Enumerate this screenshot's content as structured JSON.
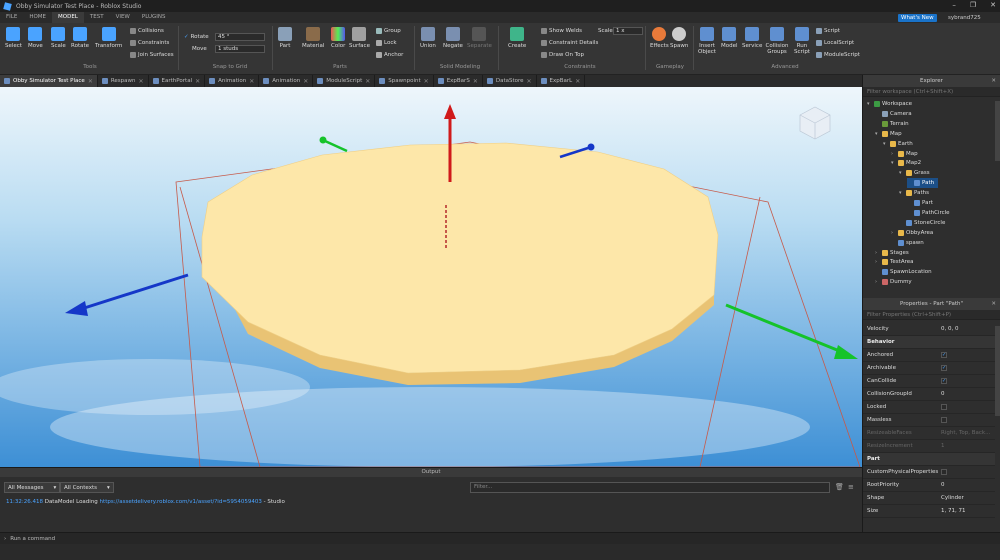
{
  "window": {
    "title": "Obby Simulator Test Place - Roblox Studio",
    "whats_new": "What's New",
    "username": "sybrand725"
  },
  "menu": [
    "FILE",
    "HOME",
    "MODEL",
    "TEST",
    "VIEW",
    "PLUGINS"
  ],
  "ribbon": {
    "tools": {
      "select": "Select",
      "move": "Move",
      "scale": "Scale",
      "rotate": "Rotate",
      "transform": "Transform",
      "label": "Tools"
    },
    "tool_options": {
      "collisions": "Collisions",
      "constraints": "Constraints",
      "join_surfaces": "Join Surfaces"
    },
    "snap": {
      "rotate_label": "Rotate",
      "rotate_value": "45 °",
      "move_label": "Move",
      "move_value": "1 studs",
      "label": "Snap to Grid"
    },
    "parts": {
      "part": "Part",
      "material": "Material",
      "color": "Color",
      "surface": "Surface",
      "group": "Group",
      "lock": "Lock",
      "anchor": "Anchor",
      "label": "Parts"
    },
    "solid": {
      "union": "Union",
      "negate": "Negate",
      "separate": "Separate",
      "label": "Solid Modeling"
    },
    "constraints": {
      "create": "Create",
      "show_welds": "Show Welds",
      "constraint_details": "Constraint Details",
      "draw_on_top": "Draw On Top",
      "scale_label": "Scale",
      "scale_value": "1 x",
      "label": "Constraints"
    },
    "gameplay": {
      "effects": "Effects",
      "spawn": "Spawn",
      "label": "Gameplay"
    },
    "advanced": {
      "insert_object": "Insert Object",
      "model": "Model",
      "service": "Service",
      "collision_groups": "Collision Groups",
      "run_script": "Run Script",
      "script": "Script",
      "local_script": "LocalScript",
      "module_script": "ModuleScript",
      "label": "Advanced"
    }
  },
  "doc_tabs": [
    {
      "label": "Obby Simulator Test Place",
      "active": true
    },
    {
      "label": "Respawn",
      "active": false
    },
    {
      "label": "EarthPortal",
      "active": false
    },
    {
      "label": "Animation",
      "active": false
    },
    {
      "label": "Animation",
      "active": false
    },
    {
      "label": "ModuleScript",
      "active": false
    },
    {
      "label": "Spawnpoint",
      "active": false
    },
    {
      "label": "ExpBarS",
      "active": false
    },
    {
      "label": "DataStore",
      "active": false
    },
    {
      "label": "ExpBarL",
      "active": false
    }
  ],
  "explorer": {
    "title": "Explorer",
    "filter_placeholder": "Filter workspace (Ctrl+Shift+X)",
    "items": [
      {
        "label": "Workspace",
        "depth": 0,
        "arrow": "▾",
        "icon": "#3c9b44"
      },
      {
        "label": "Camera",
        "depth": 1,
        "arrow": "",
        "icon": "#8aa0b8"
      },
      {
        "label": "Terrain",
        "depth": 1,
        "arrow": "",
        "icon": "#6a9a3a"
      },
      {
        "label": "Map",
        "depth": 1,
        "arrow": "▾",
        "icon": "#e8b84a"
      },
      {
        "label": "Earth",
        "depth": 2,
        "arrow": "▾",
        "icon": "#e8b84a"
      },
      {
        "label": "Map",
        "depth": 3,
        "arrow": "›",
        "icon": "#e8b84a"
      },
      {
        "label": "Map2",
        "depth": 3,
        "arrow": "▾",
        "icon": "#e8b84a"
      },
      {
        "label": "Grass",
        "depth": 4,
        "arrow": "▾",
        "icon": "#e8b84a"
      },
      {
        "label": "Path",
        "depth": 5,
        "arrow": "",
        "icon": "#5f8fd0",
        "selected": true
      },
      {
        "label": "Paths",
        "depth": 4,
        "arrow": "▾",
        "icon": "#e8b84a"
      },
      {
        "label": "Part",
        "depth": 5,
        "arrow": "",
        "icon": "#5f8fd0"
      },
      {
        "label": "PathCircle",
        "depth": 5,
        "arrow": "",
        "icon": "#5f8fd0"
      },
      {
        "label": "StoneCircle",
        "depth": 4,
        "arrow": "",
        "icon": "#5f8fd0"
      },
      {
        "label": "ObbyArea",
        "depth": 3,
        "arrow": "›",
        "icon": "#e8b84a"
      },
      {
        "label": "spawn",
        "depth": 3,
        "arrow": "",
        "icon": "#5f8fd0"
      },
      {
        "label": "Stages",
        "depth": 1,
        "arrow": "›",
        "icon": "#e8b84a"
      },
      {
        "label": "TestArea",
        "depth": 1,
        "arrow": "›",
        "icon": "#e8b84a"
      },
      {
        "label": "SpawnLocation",
        "depth": 1,
        "arrow": "",
        "icon": "#5f8fd0"
      },
      {
        "label": "Dummy",
        "depth": 1,
        "arrow": "›",
        "icon": "#c66"
      }
    ]
  },
  "properties": {
    "title": "Properties - Part \"Path\"",
    "filter_placeholder": "Filter Properties (Ctrl+Shift+P)",
    "rows": [
      {
        "name": "Velocity",
        "value": "0, 0, 0",
        "kind": "text"
      },
      {
        "name": "Behavior",
        "kind": "category"
      },
      {
        "name": "Anchored",
        "kind": "check",
        "checked": true
      },
      {
        "name": "Archivable",
        "kind": "check",
        "checked": true
      },
      {
        "name": "CanCollide",
        "kind": "check",
        "checked": true
      },
      {
        "name": "CollisionGroupId",
        "value": "0",
        "kind": "text"
      },
      {
        "name": "Locked",
        "kind": "check",
        "checked": false
      },
      {
        "name": "Massless",
        "kind": "check",
        "checked": false
      },
      {
        "name": "ResizeableFaces",
        "value": "Right, Top, Back...",
        "kind": "disabled"
      },
      {
        "name": "ResizeIncrement",
        "value": "1",
        "kind": "disabled"
      },
      {
        "name": "Part",
        "kind": "category"
      },
      {
        "name": "CustomPhysicalProperties",
        "kind": "check",
        "checked": false
      },
      {
        "name": "RootPriority",
        "value": "0",
        "kind": "text"
      },
      {
        "name": "Shape",
        "value": "Cylinder",
        "kind": "text"
      },
      {
        "name": "Size",
        "value": "1, 71, 71",
        "kind": "text"
      }
    ]
  },
  "output": {
    "title": "Output",
    "messages_select": "All Messages",
    "contexts_select": "All Contexts",
    "filter_placeholder": "Filter...",
    "log": {
      "time": "11:32:26.418",
      "text": "DataModel Loading",
      "url": "https://assetdelivery.roblox.com/v1/asset/?id=5954059403",
      "source": "- Studio"
    }
  },
  "command_bar": {
    "placeholder": "Run a command"
  },
  "colors": {
    "accent": "#1a73c9",
    "selection": "#1c4f87",
    "disc_top": "#fde7a9",
    "disc_side": "#e9c374",
    "sky_top": "#e9f4fb",
    "sky_bottom": "#3a8fd6"
  }
}
